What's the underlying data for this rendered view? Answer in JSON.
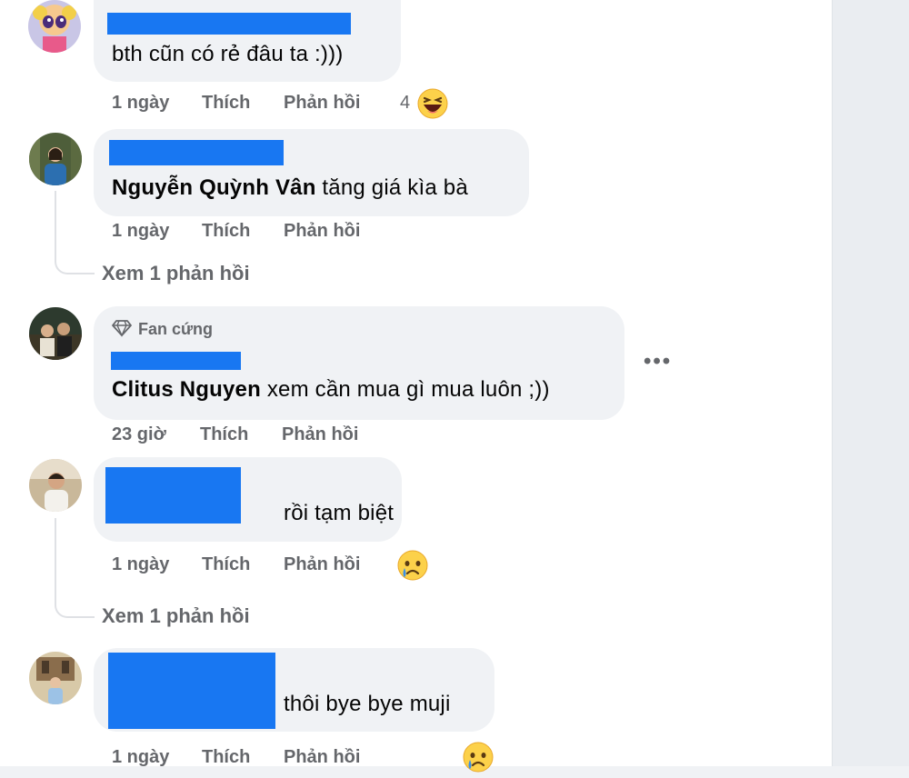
{
  "comments": [
    {
      "text": "bth cũn có rẻ đâu ta :)))",
      "time": "1 ngày",
      "like": "Thích",
      "reply": "Phản hồi",
      "reaction_count": "4",
      "reaction_icon": "laughing-emoji-icon"
    },
    {
      "mention": "Nguyễn Quỳnh Vân",
      "text": " tăng giá kìa bà",
      "time": "1 ngày",
      "like": "Thích",
      "reply": "Phản hồi",
      "view_replies": "Xem 1 phản hồi"
    },
    {
      "badge": "Fan cứng",
      "badge_icon": "diamond-icon",
      "mention": "Clitus Nguyen",
      "text": " xem cần mua gì mua luôn ;))",
      "time": "23 giờ",
      "like": "Thích",
      "reply": "Phản hồi",
      "more_icon": "more-options-icon"
    },
    {
      "text": "rồi tạm biệt",
      "time": "1 ngày",
      "like": "Thích",
      "reply": "Phản hồi",
      "reaction_icon": "sad-tear-emoji-icon",
      "view_replies": "Xem 1 phản hồi"
    },
    {
      "text": "thôi bye bye muji",
      "time": "1 ngày",
      "like": "Thích",
      "reply": "Phản hồi",
      "reaction_icon": "sad-tear-emoji-icon"
    }
  ],
  "colors": {
    "redaction": "#1877f2",
    "bubble": "#f0f2f5",
    "meta_text": "#65676b",
    "thread_line": "#dfe1e5"
  }
}
